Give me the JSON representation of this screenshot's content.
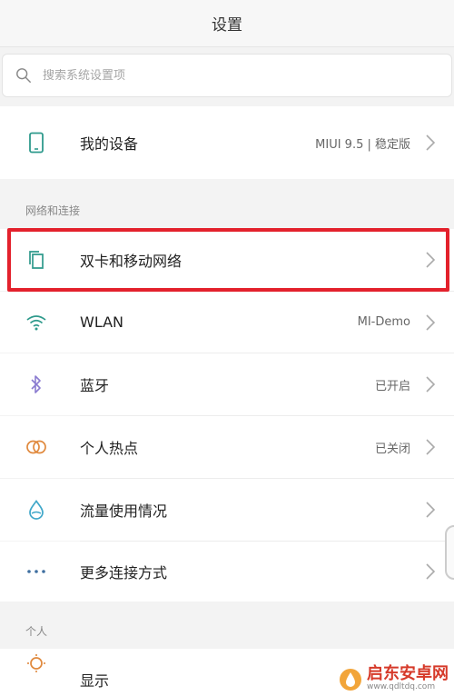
{
  "header": {
    "title": "设置"
  },
  "search": {
    "placeholder": "搜索系统设置项"
  },
  "my_device": {
    "label": "我的设备",
    "value": "MIUI 9.5 | 稳定版"
  },
  "section_network": "网络和连接",
  "network_items": [
    {
      "label": "双卡和移动网络",
      "value": ""
    },
    {
      "label": "WLAN",
      "value": "MI-Demo"
    },
    {
      "label": "蓝牙",
      "value": "已开启"
    },
    {
      "label": "个人热点",
      "value": "已关闭"
    },
    {
      "label": "流量使用情况",
      "value": ""
    },
    {
      "label": "更多连接方式",
      "value": ""
    }
  ],
  "section_personal": "个人",
  "personal_items": [
    {
      "label": "显示"
    }
  ],
  "watermark": {
    "text": "启东安卓网",
    "url": "www.qdltdq.com"
  },
  "colors": {
    "icon_teal": "#2f9a8c",
    "highlight": "#e3212c",
    "bluetooth": "#8a7bd0",
    "hotspot": "#e0893d",
    "data": "#3fa7c9",
    "display": "#e0893d"
  },
  "icons": {
    "search": "search-icon",
    "device": "phone-icon",
    "sim": "sim-card-icon",
    "wlan": "wifi-icon",
    "bluetooth": "bluetooth-icon",
    "hotspot": "hotspot-icon",
    "data": "data-drop-icon",
    "more": "more-dots-icon",
    "display": "sun-icon"
  }
}
